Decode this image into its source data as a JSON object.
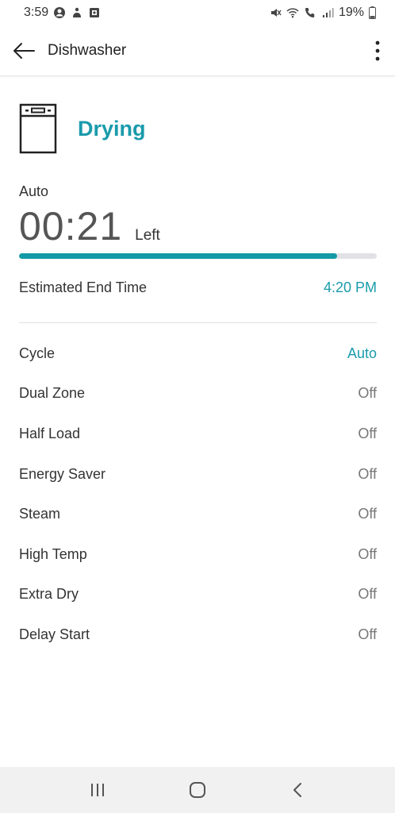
{
  "status_bar": {
    "time": "3:59",
    "battery": "19%",
    "icons": [
      "account-circle-icon",
      "notification-icon",
      "screen-icon",
      "mute-icon",
      "wifi-icon",
      "wifi-calling-icon",
      "signal-icon",
      "battery-icon"
    ]
  },
  "app_bar": {
    "title": "Dishwasher",
    "back_icon": "arrow-left-icon",
    "menu_icon": "more-vert-icon"
  },
  "status": {
    "state": "Drying",
    "appliance_icon": "dishwasher-icon",
    "mode": "Auto",
    "time_left": "00:21",
    "time_left_unit": "Left",
    "progress": 0.89
  },
  "estimated_end": {
    "label": "Estimated End Time",
    "value": "4:20 PM"
  },
  "settings": [
    {
      "label": "Cycle",
      "value": "Auto"
    },
    {
      "label": "Dual Zone",
      "value": "Off"
    },
    {
      "label": "Half Load",
      "value": "Off"
    },
    {
      "label": "Energy Saver",
      "value": "Off"
    },
    {
      "label": "Steam",
      "value": "Off"
    },
    {
      "label": "High Temp",
      "value": "Off"
    },
    {
      "label": "Extra Dry",
      "value": "Off"
    },
    {
      "label": "Delay Start",
      "value": "Off"
    }
  ],
  "colors": {
    "accent": "#1a9bab",
    "progress": "#149aa6",
    "track": "#e2e2e6"
  },
  "nav_bar": {
    "icons": [
      "recent-apps-icon",
      "home-icon",
      "back-icon"
    ]
  }
}
